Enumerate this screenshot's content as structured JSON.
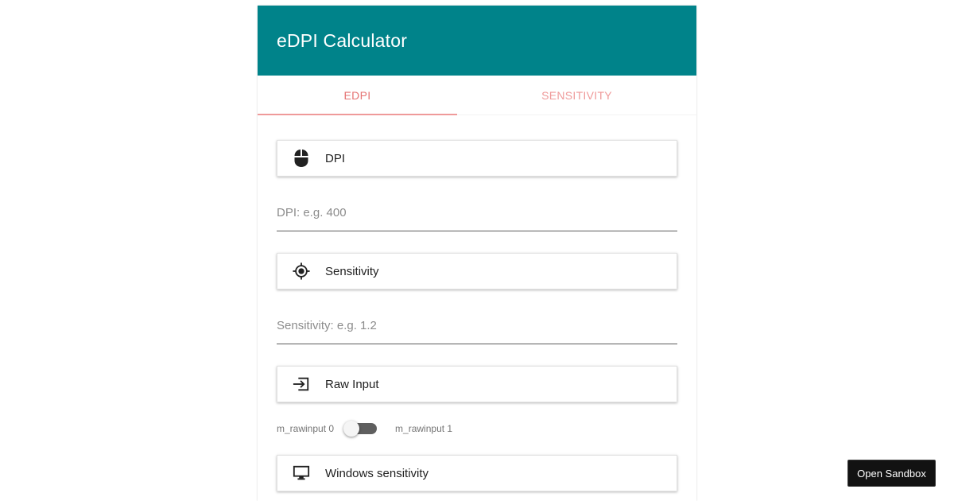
{
  "app": {
    "title": "eDPI Calculator",
    "accent_color": "#00838a",
    "tab_color": "#e57373"
  },
  "tabs": [
    {
      "label": "EDPI",
      "active": true
    },
    {
      "label": "SENSITIVITY",
      "active": false
    }
  ],
  "sections": {
    "dpi": {
      "label": "DPI",
      "icon": "mouse-icon"
    },
    "sensitivity": {
      "label": "Sensitivity",
      "icon": "crosshair-icon"
    },
    "raw_input": {
      "label": "Raw Input",
      "icon": "input-icon"
    },
    "windows": {
      "label": "Windows sensitivity",
      "icon": "monitor-icon"
    }
  },
  "fields": {
    "dpi": {
      "placeholder": "DPI: e.g. 400",
      "value": ""
    },
    "sensitivity": {
      "placeholder": "Sensitivity: e.g. 1.2",
      "value": ""
    }
  },
  "raw_input_toggle": {
    "off_label": "m_rawinput 0",
    "on_label": "m_rawinput 1",
    "checked": false
  },
  "sandbox_button": {
    "label": "Open Sandbox"
  }
}
